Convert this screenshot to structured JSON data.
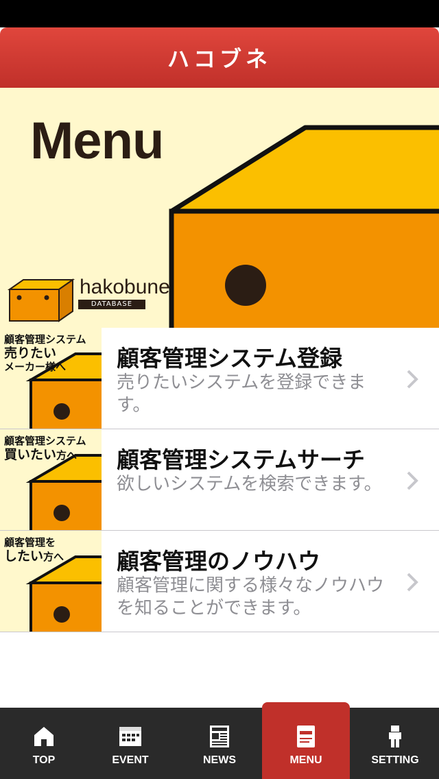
{
  "header": {
    "title": "ハコブネ"
  },
  "banner": {
    "heading": "Menu",
    "logo_wordmark": "hakobune",
    "logo_sub": "DATABASE"
  },
  "menu_items": [
    {
      "thumb_line1": "顧客管理システム",
      "thumb_line2": "売りたい",
      "thumb_line3": "メーカー様へ",
      "title": "顧客管理システム登録",
      "description": "売りたいシステムを登録できます。"
    },
    {
      "thumb_line1": "顧客管理システム",
      "thumb_line2": "買いたい",
      "thumb_line3": "方へ",
      "title": "顧客管理システムサーチ",
      "description": "欲しいシステムを検索できます。"
    },
    {
      "thumb_line1": "顧客管理を",
      "thumb_line2": "したい",
      "thumb_line3": "方へ",
      "title": "顧客管理のノウハウ",
      "description": "顧客管理に関する様々なノウハウを知ることができます。"
    }
  ],
  "tabs": [
    {
      "label": "TOP",
      "icon": "home-icon"
    },
    {
      "label": "EVENT",
      "icon": "calendar-icon"
    },
    {
      "label": "NEWS",
      "icon": "newspaper-icon"
    },
    {
      "label": "MENU",
      "icon": "menu-book-icon",
      "active": true
    },
    {
      "label": "SETTING",
      "icon": "person-icon"
    }
  ],
  "colors": {
    "header_red": "#c0302a",
    "banner_bg": "#fff8cc",
    "box_orange": "#f39200",
    "box_top_yellow": "#fbbf00",
    "outline": "#2b1d14",
    "tabbar_bg": "#2a2a2a"
  }
}
